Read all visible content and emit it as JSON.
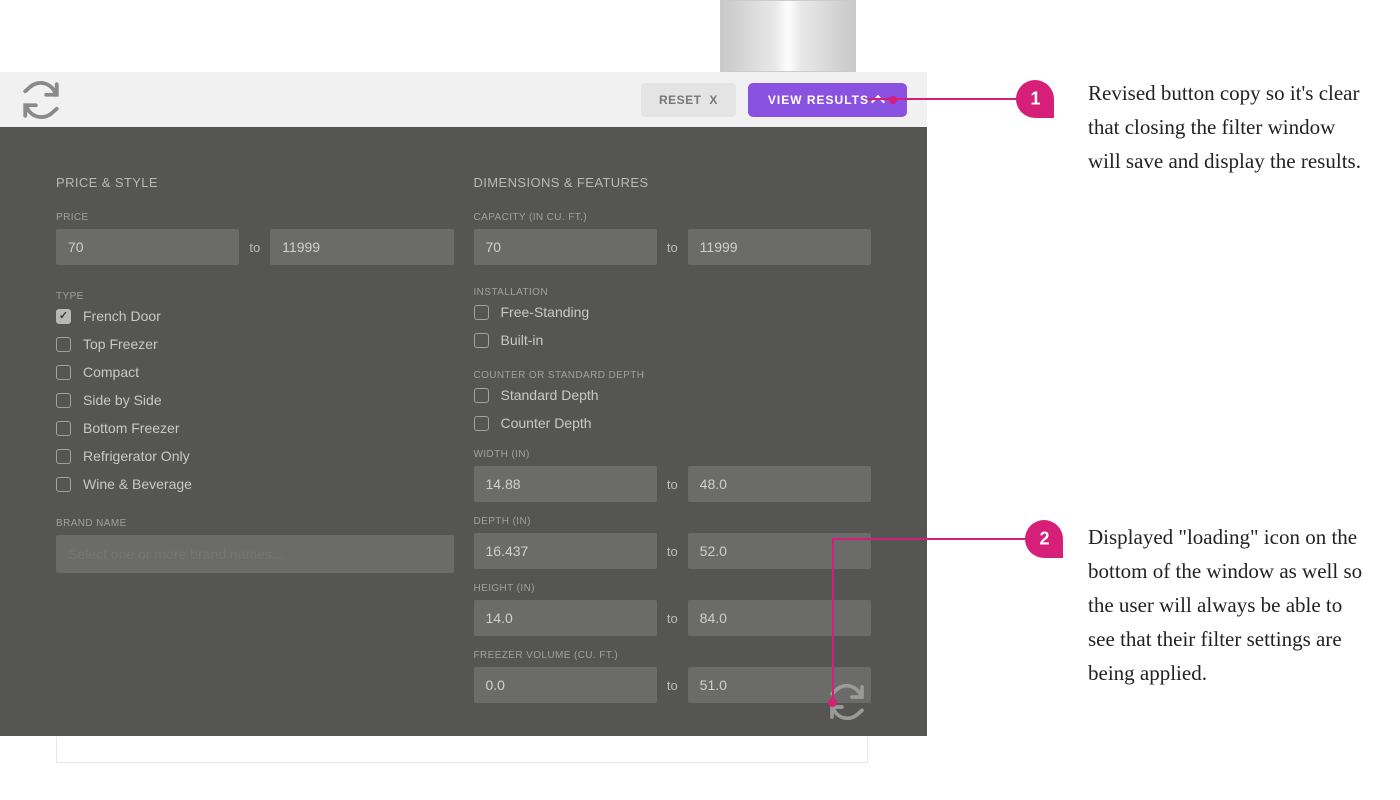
{
  "header": {
    "reset_label": "RESET",
    "reset_x": "X",
    "view_label": "VIEW RESULTS"
  },
  "left": {
    "title": "PRICE & STYLE",
    "price": {
      "label": "PRICE",
      "from": "70",
      "to_word": "to",
      "to": "11999"
    },
    "type": {
      "label": "TYPE",
      "items": [
        {
          "label": "French Door",
          "checked": true
        },
        {
          "label": "Top Freezer",
          "checked": false
        },
        {
          "label": "Compact",
          "checked": false
        },
        {
          "label": "Side by Side",
          "checked": false
        },
        {
          "label": "Bottom Freezer",
          "checked": false
        },
        {
          "label": "Refrigerator Only",
          "checked": false
        },
        {
          "label": "Wine & Beverage",
          "checked": false
        }
      ]
    },
    "brand": {
      "label": "BRAND NAME",
      "placeholder": "Select one or more brand names..."
    }
  },
  "right": {
    "title": "DIMENSIONS & FEATURES",
    "capacity": {
      "label": "CAPACITY (IN CU. FT.)",
      "from": "70",
      "to_word": "to",
      "to": "11999"
    },
    "installation": {
      "label": "INSTALLATION",
      "items": [
        {
          "label": "Free-Standing",
          "checked": false
        },
        {
          "label": "Built-in",
          "checked": false
        }
      ]
    },
    "depth": {
      "label": "COUNTER OR STANDARD DEPTH",
      "items": [
        {
          "label": "Standard Depth",
          "checked": false
        },
        {
          "label": "Counter Depth",
          "checked": false
        }
      ]
    },
    "width": {
      "label": "WIDTH (IN)",
      "from": "14.88",
      "to_word": "to",
      "to": "48.0"
    },
    "depth_in": {
      "label": "DEPTH (IN)",
      "from": "16.437",
      "to_word": "to",
      "to": "52.0"
    },
    "height": {
      "label": "HEIGHT (IN)",
      "from": "14.0",
      "to_word": "to",
      "to": "84.0"
    },
    "freezer": {
      "label": "FREEZER VOLUME (CU. FT.)",
      "from": "0.0",
      "to_word": "to",
      "to": "51.0"
    }
  },
  "annotations": {
    "a1": {
      "number": "1",
      "text": "Revised button copy so it's clear that closing the filter window will save and display the results."
    },
    "a2": {
      "number": "2",
      "text": "Displayed \"loading\" icon on the bottom of the window as well so the user will always be able to see that their filter settings are being applied."
    }
  }
}
